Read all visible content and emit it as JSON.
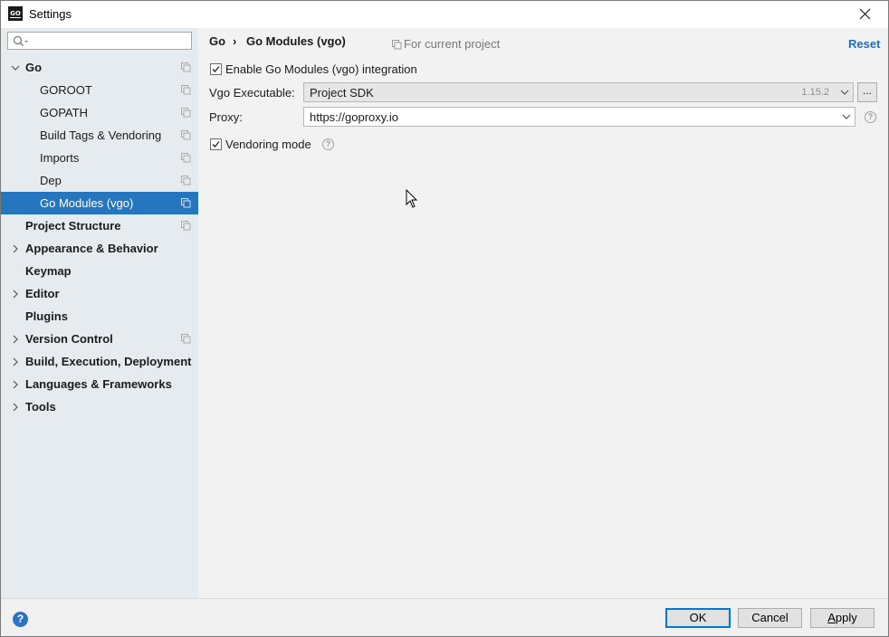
{
  "window": {
    "title": "Settings",
    "app_icon_text": "GO"
  },
  "sidebar": {
    "search": {
      "value": "",
      "placeholder": ""
    },
    "items": [
      {
        "label": "Go",
        "bold": true,
        "expanded": true,
        "scope_icon": true
      },
      {
        "label": "GOROOT",
        "scope_icon": true
      },
      {
        "label": "GOPATH",
        "scope_icon": true
      },
      {
        "label": "Build Tags & Vendoring",
        "scope_icon": true
      },
      {
        "label": "Imports",
        "scope_icon": true
      },
      {
        "label": "Dep",
        "scope_icon": true
      },
      {
        "label": "Go Modules (vgo)",
        "selected": true,
        "scope_icon": true
      },
      {
        "label": "Project Structure",
        "bold": true,
        "scope_icon": true
      },
      {
        "label": "Appearance & Behavior",
        "bold": true,
        "collapsed": true
      },
      {
        "label": "Keymap",
        "bold": true
      },
      {
        "label": "Editor",
        "bold": true,
        "collapsed": true
      },
      {
        "label": "Plugins",
        "bold": true
      },
      {
        "label": "Version Control",
        "bold": true,
        "collapsed": true,
        "scope_icon": true
      },
      {
        "label": "Build, Execution, Deployment",
        "bold": true,
        "collapsed": true
      },
      {
        "label": "Languages & Frameworks",
        "bold": true,
        "collapsed": true
      },
      {
        "label": "Tools",
        "bold": true,
        "collapsed": true
      }
    ]
  },
  "header": {
    "breadcrumb_parent": "Go",
    "breadcrumb_separator": "›",
    "breadcrumb_current": "Go Modules (vgo)",
    "scope_note": "For current project",
    "reset_label": "Reset"
  },
  "settings": {
    "enable_label": "Enable Go Modules (vgo) integration",
    "enable_checked": true,
    "executable_label": "Vgo Executable:",
    "executable_value": "Project SDK",
    "executable_version": "1.15.2",
    "browse_label": "...",
    "proxy_label": "Proxy:",
    "proxy_value": "https://goproxy.io",
    "vendoring_label": "Vendoring mode",
    "vendoring_checked": true,
    "help_glyph": "?"
  },
  "footer": {
    "help_glyph": "?",
    "ok_label": "OK",
    "cancel_label": "Cancel",
    "apply_label": "Apply",
    "apply_mnemonic": "A",
    "apply_rest": "pply"
  },
  "colors": {
    "accent": "#2675bf",
    "link": "#2470b3",
    "sidebar_bg": "#e6ebf0",
    "dialog_bg": "#f2f2f2"
  }
}
